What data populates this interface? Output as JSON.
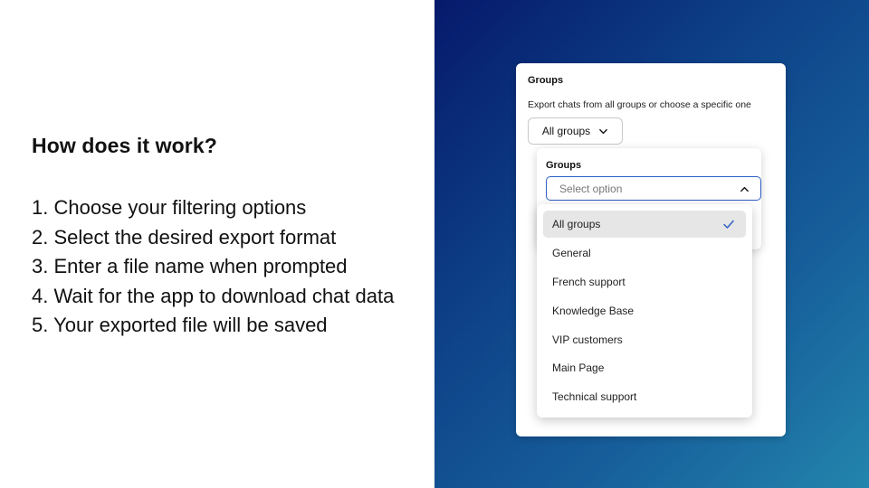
{
  "left": {
    "heading": "How does it work?",
    "steps": [
      "1. Choose your filtering options",
      "2. Select the desired export format",
      "3. Enter a file name when prompted",
      "4. Wait for the app to download chat data",
      "5. Your exported file will be saved"
    ]
  },
  "card": {
    "title": "Groups",
    "description": "Export chats from all groups or choose a specific one",
    "groups_button_label": "All groups"
  },
  "popover": {
    "title": "Groups",
    "select_placeholder": "Select option"
  },
  "menu": {
    "selected_index": 0,
    "items": [
      "All groups",
      "General",
      "French support",
      "Knowledge Base",
      "VIP customers",
      "Main Page",
      "Technical support"
    ]
  },
  "colors": {
    "accent": "#2f5fc4",
    "gradient_start": "#06196b",
    "gradient_end": "#2385ac",
    "selected_bg": "#e6e6e6"
  },
  "icons": {
    "groups_button": "chevron-down-icon",
    "select": "chevron-up-icon",
    "selected_item": "check-icon"
  }
}
